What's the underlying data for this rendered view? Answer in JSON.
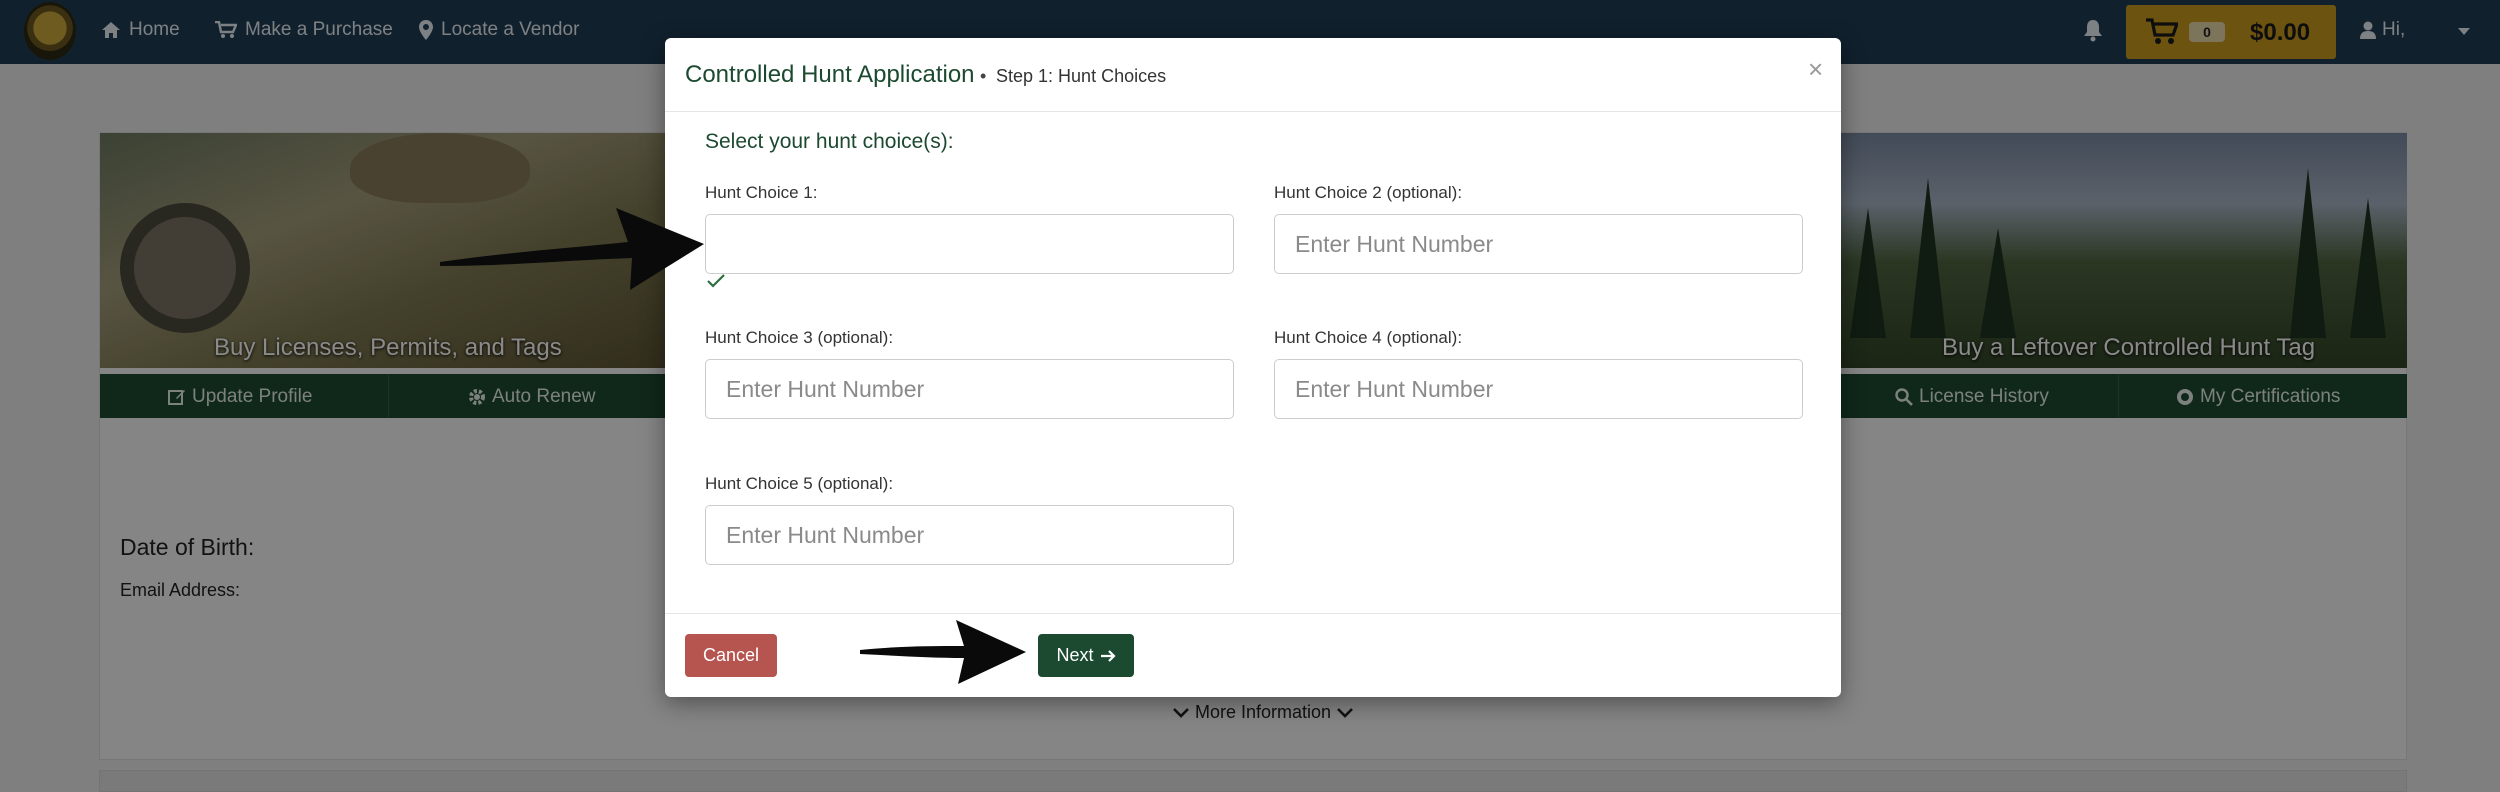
{
  "navbar": {
    "home": "Home",
    "make_purchase": "Make a Purchase",
    "locate_vendor": "Locate a Vendor",
    "cart_count": "0",
    "cart_total": "$0.00",
    "user_greeting": "Hi,"
  },
  "banners": {
    "left_caption": "Buy Licenses, Permits, and Tags",
    "right_caption": "Buy a Leftover Controlled Hunt Tag"
  },
  "green_bar": {
    "update_profile": "Update Profile",
    "auto_renew": "Auto Renew",
    "license_history": "License History",
    "my_certifications": "My Certifications"
  },
  "page": {
    "dob_label": "Date of Birth:",
    "email_label": "Email Address:",
    "more_info": "More Information"
  },
  "modal": {
    "title": "Controlled Hunt Application",
    "separator": "•",
    "step": "Step 1: Hunt Choices",
    "close": "×",
    "select_label": "Select your hunt choice(s):",
    "choices": [
      {
        "label": "Hunt Choice 1:",
        "value": "",
        "placeholder": ""
      },
      {
        "label": "Hunt Choice 2 (optional):",
        "value": "",
        "placeholder": "Enter Hunt Number"
      },
      {
        "label": "Hunt Choice 3 (optional):",
        "value": "",
        "placeholder": "Enter Hunt Number"
      },
      {
        "label": "Hunt Choice 4 (optional):",
        "value": "",
        "placeholder": "Enter Hunt Number"
      },
      {
        "label": "Hunt Choice 5 (optional):",
        "value": "",
        "placeholder": "Enter Hunt Number"
      }
    ],
    "cancel_label": "Cancel",
    "next_label": "Next"
  },
  "colors": {
    "navbar": "#1f3c53",
    "brand_green": "#1c4a30",
    "cart_gold": "#c99a1e",
    "cancel_red": "#b6544f"
  }
}
